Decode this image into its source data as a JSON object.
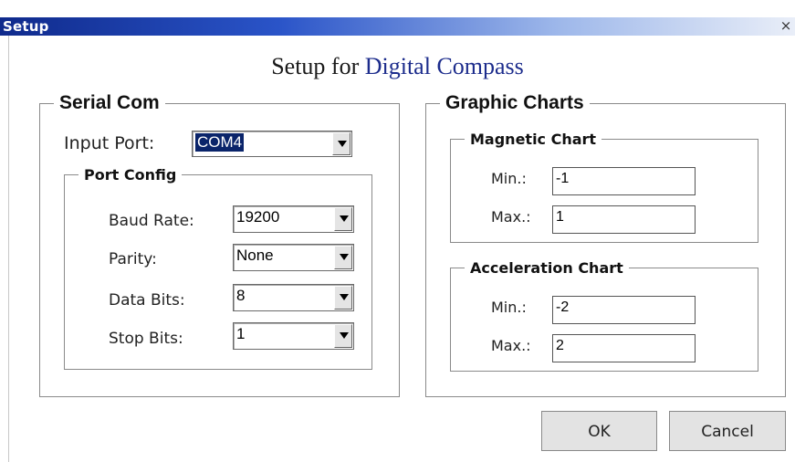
{
  "window": {
    "title": "Setup",
    "close_glyph": "×"
  },
  "heading": {
    "prefix": "Setup for",
    "accent": "Digital Compass"
  },
  "serial_com": {
    "legend": "Serial Com",
    "input_port_label": "Input Port:",
    "input_port_value": "COM4",
    "port_config": {
      "legend": "Port Config",
      "baud_rate_label": "Baud Rate:",
      "baud_rate_value": "19200",
      "parity_label": "Parity:",
      "parity_value": "None",
      "data_bits_label": "Data Bits:",
      "data_bits_value": "8",
      "stop_bits_label": "Stop Bits:",
      "stop_bits_value": "1"
    }
  },
  "graphic_charts": {
    "legend": "Graphic Charts",
    "magnetic": {
      "legend": "Magnetic Chart",
      "min_label": "Min.:",
      "min_value": "-1",
      "max_label": "Max.:",
      "max_value": "1"
    },
    "acceleration": {
      "legend": "Acceleration Chart",
      "min_label": "Min.:",
      "min_value": "-2",
      "max_label": "Max.:",
      "max_value": "2"
    }
  },
  "buttons": {
    "ok": "OK",
    "cancel": "Cancel"
  },
  "colors": {
    "titlebar_start": "#0f2a8c",
    "heading_accent": "#1c2c8c",
    "selection": "#0a246a"
  }
}
